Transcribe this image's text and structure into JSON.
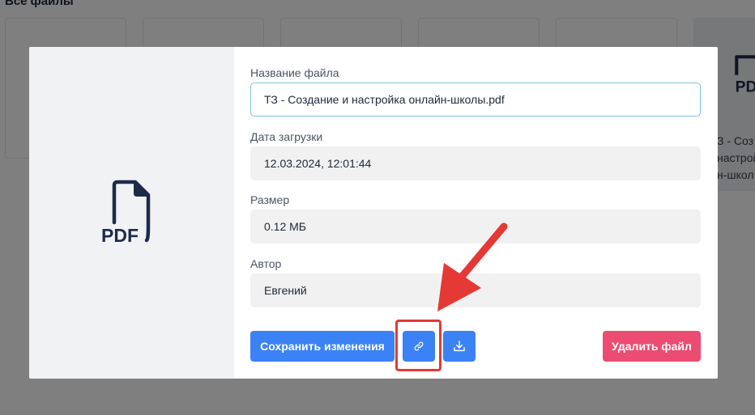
{
  "background": {
    "section_title": "Все файлы",
    "selected_card": {
      "icon": "pdf-file-icon",
      "label": "З - Соз\nнастройк\nн-школ"
    }
  },
  "modal": {
    "preview": {
      "icon": "pdf-file-icon",
      "icon_text": "PDF"
    },
    "fields": {
      "name": {
        "label": "Название файла",
        "value": "ТЗ - Создание и настройка онлайн-школы.pdf"
      },
      "date": {
        "label": "Дата загрузки",
        "value": "12.03.2024, 12:01:44"
      },
      "size": {
        "label": "Размер",
        "value": "0.12 МБ"
      },
      "author": {
        "label": "Автор",
        "value": "Евгений"
      }
    },
    "buttons": {
      "save": "Сохранить изменения",
      "copy_link_icon": "link-icon",
      "download_icon": "download-icon",
      "delete": "Удалить файл"
    }
  },
  "annotation": {
    "highlight_color": "#e53935",
    "arrow_icon": "red-arrow-icon"
  },
  "colors": {
    "primary": "#3b82f6",
    "danger": "#ec4c72",
    "icon_navy": "#1e2a4a"
  }
}
